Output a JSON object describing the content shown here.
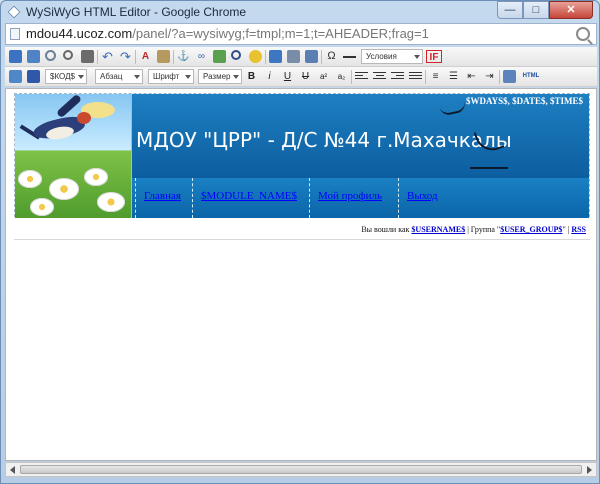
{
  "window": {
    "title": "WySiWyG HTML Editor - Google Chrome",
    "minimize": "—",
    "maximize": "□",
    "close": "✕"
  },
  "address": {
    "host": "mdou44.ucoz.com",
    "path": "/panel/?a=wysiwyg;f=tmpl;m=1;t=AHEADER;frag=1"
  },
  "toolbar1": {
    "icons": [
      "save-icon",
      "floppy-icon",
      "preview-icon",
      "find-icon",
      "binoculars-icon",
      "undo-icon",
      "redo-icon",
      "text-color-icon",
      "background-color-icon",
      "anchor-icon",
      "link-icon",
      "image-icon",
      "flash-icon",
      "smile-icon",
      "table-icon",
      "edit-icon",
      "form-icon",
      "special-char-icon",
      "horizontal-rule-icon"
    ],
    "conditions_label": "Условия",
    "if_label": "IF"
  },
  "toolbar2": {
    "code_label": "$КОД$",
    "paragraph_label": "Абзац",
    "font_label": "Шрифт",
    "size_label": "Размер",
    "format_buttons": [
      "B",
      "i",
      "U",
      "U",
      "a²",
      "a₂"
    ],
    "html_label": "HTML"
  },
  "page": {
    "banner_meta": "$WDAYS$, $DATE$, $TIME$",
    "title": "МДОУ \"ЦРР\" - Д/С №44 г.Махачкалы",
    "nav": [
      "Главная",
      "$MODULE_NAME$",
      "Мой профиль",
      "Выход"
    ],
    "status_prefix": "Вы вошли как",
    "username": "$USERNAME$",
    "group_prefix": "| Группа \"",
    "group": "$USER_GROUP$",
    "group_suffix": "\" |",
    "rss": "RSS"
  }
}
